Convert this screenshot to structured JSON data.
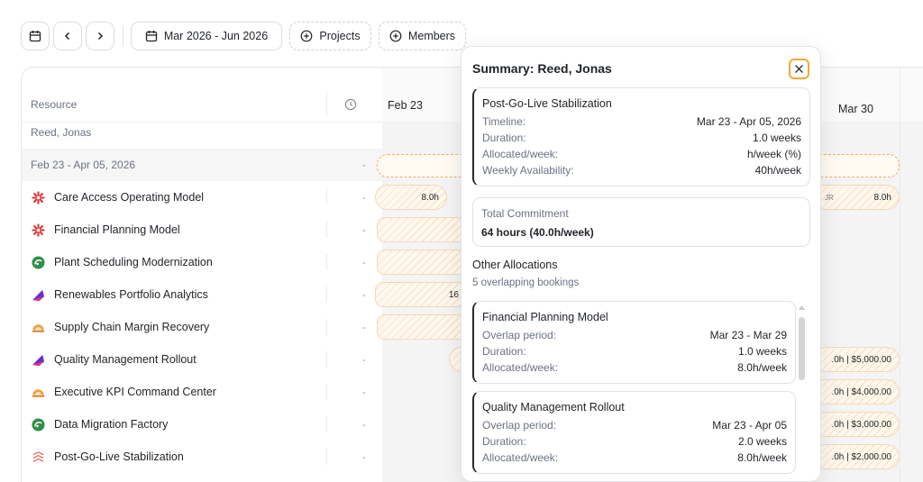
{
  "toolbar": {
    "date_range": "Mar 2026 - Jun 2026",
    "projects_label": "Projects",
    "members_label": "Members"
  },
  "table": {
    "resource_header": "Resource",
    "owner": "Reed, Jonas",
    "group": {
      "label": "Feb 23 - Apr 05, 2026",
      "value": "-"
    },
    "rows": [
      {
        "label": "Care Access Operating Model",
        "value": "-",
        "icon": "red-burst-icon",
        "color": "#e0312f"
      },
      {
        "label": "Financial Planning Model",
        "value": "-",
        "icon": "red-burst-icon",
        "color": "#e0312f"
      },
      {
        "label": "Plant Scheduling Modernization",
        "value": "-",
        "icon": "green-circle-icon",
        "color": "#2f8f46"
      },
      {
        "label": "Renewables Portfolio Analytics",
        "value": "-",
        "icon": "purple-wing-icon",
        "color": "#6b2bd6"
      },
      {
        "label": "Supply Chain Margin Recovery",
        "value": "-",
        "icon": "sunrise-icon",
        "color": "#e6a23c"
      },
      {
        "label": "Quality Management Rollout",
        "value": "-",
        "icon": "purple-wing-icon",
        "color": "#6b2bd6"
      },
      {
        "label": "Executive KPI Command Center",
        "value": "-",
        "icon": "sunrise-icon",
        "color": "#e6a23c"
      },
      {
        "label": "Data Migration Factory",
        "value": "-",
        "icon": "green-circle-icon",
        "color": "#2f8f46"
      },
      {
        "label": "Post-Go-Live Stabilization",
        "value": "-",
        "icon": "red-wave-icon",
        "color": "#ef5a4f"
      }
    ]
  },
  "timeline": {
    "dates": [
      "Feb 23",
      "Mar 30"
    ],
    "bar_labels": {
      "care_left": "8.0h",
      "care_right": "8.0h",
      "care_right_prefix": "JR",
      "renewables_partial": "16",
      "quality_right": ".0h | $5,000.00",
      "exec_right": ".0h | $4,000.00",
      "data_right": ".0h | $3,000.00",
      "post_right": ".0h | $2,000.00"
    }
  },
  "summary": {
    "title": "Summary: Reed, Jonas",
    "project_card": {
      "title": "Post-Go-Live Stabilization",
      "rows": [
        {
          "k": "Timeline:",
          "v": "Mar 23 - Apr 05, 2026"
        },
        {
          "k": "Duration:",
          "v": "1.0 weeks"
        },
        {
          "k": "Allocated/week:",
          "v": "h/week (%)"
        },
        {
          "k": "Weekly Availability:",
          "v": "40h/week"
        }
      ]
    },
    "total": {
      "label": "Total Commitment",
      "value": "64 hours (40.0h/week)"
    },
    "other": {
      "title": "Other Allocations",
      "subtitle": "5 overlapping bookings",
      "cards": [
        {
          "title": "Financial Planning Model",
          "rows": [
            {
              "k": "Overlap period:",
              "v": "Mar 23 - Mar 29"
            },
            {
              "k": "Duration:",
              "v": "1.0 weeks"
            },
            {
              "k": "Allocated/week:",
              "v": "8.0h/week"
            }
          ]
        },
        {
          "title": "Quality Management Rollout",
          "rows": [
            {
              "k": "Overlap period:",
              "v": "Mar 23 - Apr 05"
            },
            {
              "k": "Duration:",
              "v": "2.0 weeks"
            },
            {
              "k": "Allocated/week:",
              "v": "8.0h/week"
            }
          ]
        }
      ]
    }
  }
}
